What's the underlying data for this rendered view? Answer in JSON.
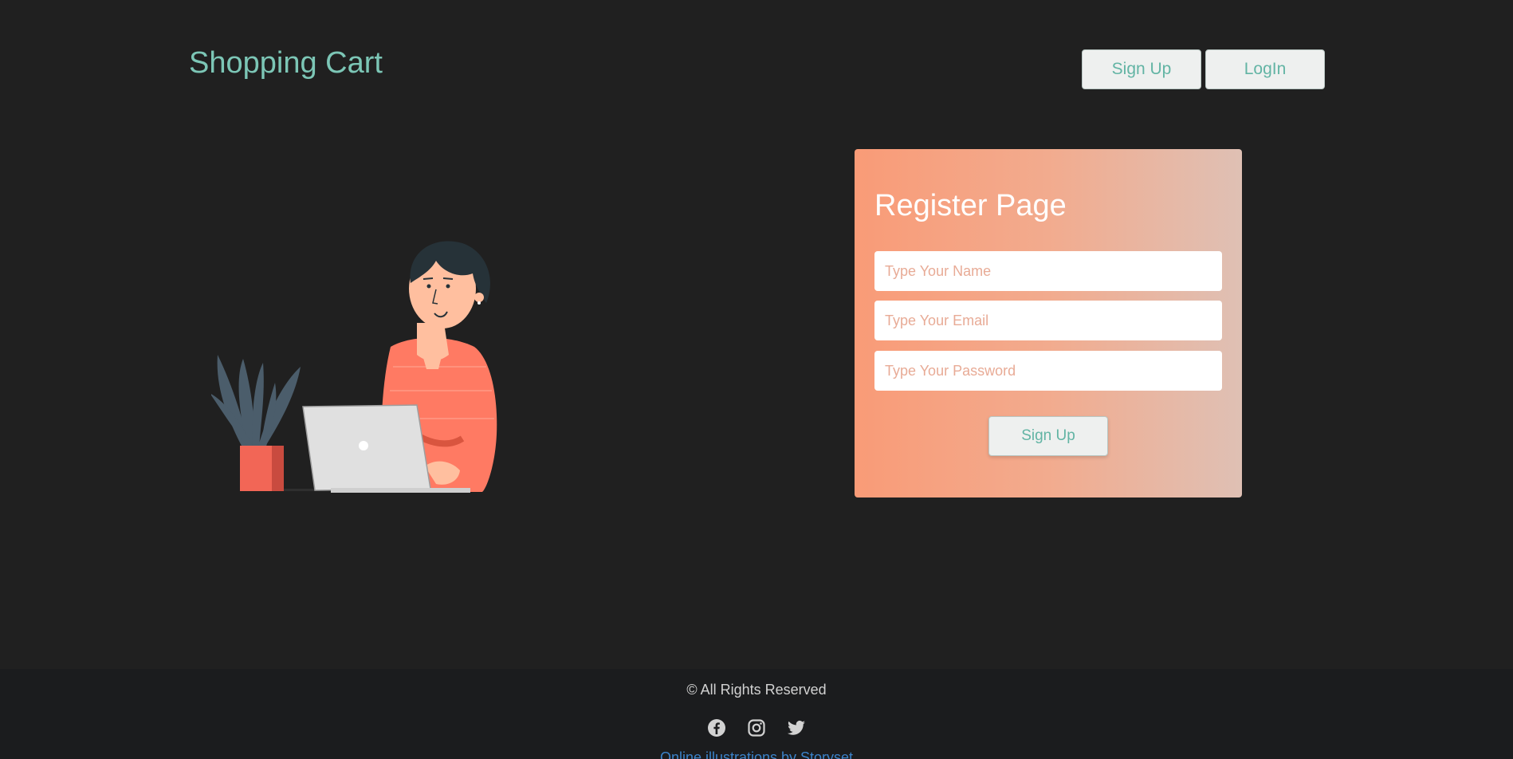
{
  "header": {
    "brand": "Shopping Cart",
    "signup_label": "Sign Up",
    "login_label": "LogIn"
  },
  "register": {
    "title": "Register Page",
    "name_placeholder": "Type Your Name",
    "email_placeholder": "Type Your Email",
    "password_placeholder": "Type Your Password",
    "submit_label": "Sign Up"
  },
  "footer": {
    "copyright": "© All Rights Reserved",
    "socials": [
      "facebook-icon",
      "instagram-icon",
      "twitter-icon"
    ],
    "credit": "Online illustrations by Storyset"
  },
  "colors": {
    "background": "#202020",
    "accent": "#7cc6b6",
    "card_gradient_start": "#f99b77",
    "card_gradient_end": "#dfc0b4",
    "footer_bg": "#1b1c1e",
    "link": "#3b82c9"
  }
}
